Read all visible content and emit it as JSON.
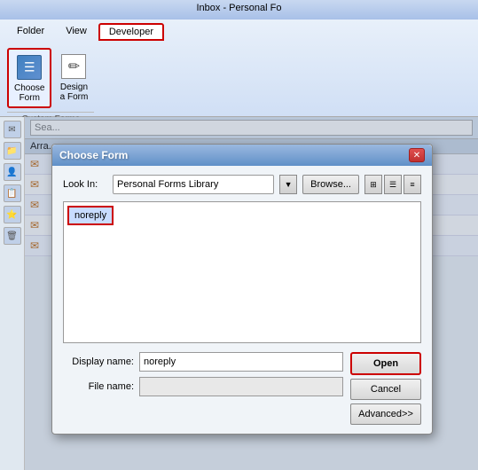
{
  "window": {
    "title": "Inbox - Personal Fo"
  },
  "ribbon": {
    "tabs": [
      {
        "label": "Folder",
        "active": false
      },
      {
        "label": "View",
        "active": false
      },
      {
        "label": "Developer",
        "active": true,
        "highlighted": true
      }
    ],
    "groups": [
      {
        "label": "Custom Forms",
        "buttons": [
          {
            "id": "choose-form",
            "label": "Choose\nForm",
            "highlighted": true
          },
          {
            "id": "design-form",
            "label": "Design\na Form",
            "highlighted": false
          }
        ]
      }
    ]
  },
  "dialog": {
    "title": "Choose Form",
    "close_label": "✕",
    "look_in": {
      "label": "Look In:",
      "value": "Personal Forms Library"
    },
    "browse_button": "Browse...",
    "forms_list": [
      {
        "name": "noreply"
      }
    ],
    "display_name": {
      "label": "Display name:",
      "value": "noreply"
    },
    "file_name": {
      "label": "File name:",
      "value": ""
    },
    "buttons": {
      "open": "Open",
      "cancel": "Cancel",
      "advanced": "Advanced>>"
    }
  },
  "sidebar": {
    "icons": [
      "✉",
      "📁",
      "👤",
      "📋",
      "⭐",
      "🗑"
    ]
  },
  "search": {
    "placeholder": "Sea..."
  },
  "email_list": {
    "header": "Arra...",
    "items": [
      {
        "icon": "✉",
        "text": ""
      },
      {
        "icon": "✉",
        "text": ""
      },
      {
        "icon": "✉",
        "text": ""
      },
      {
        "icon": "✉",
        "text": ""
      },
      {
        "icon": "✉",
        "text": ""
      }
    ]
  }
}
